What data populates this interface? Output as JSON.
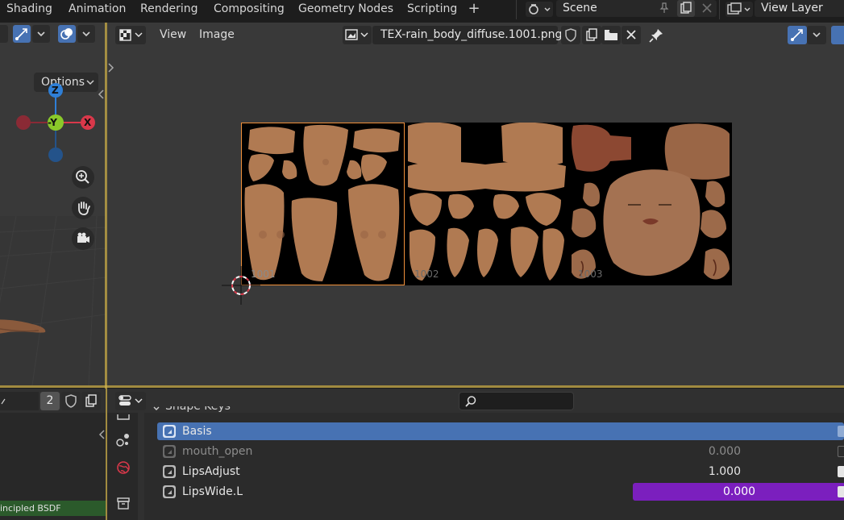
{
  "workspaces": [
    {
      "label": "Shading"
    },
    {
      "label": "Animation"
    },
    {
      "label": "Rendering"
    },
    {
      "label": "Compositing"
    },
    {
      "label": "Geometry Nodes"
    },
    {
      "label": "Scripting"
    }
  ],
  "add_workspace_label": "+",
  "scene": {
    "label": "Scene"
  },
  "view_layer": {
    "label": "View Layer"
  },
  "viewport3d": {
    "options_label": "Options",
    "gizmo": {
      "z": "Z",
      "y": "-Y",
      "x": "X"
    }
  },
  "image_editor": {
    "menu": {
      "view": "View",
      "image": "Image"
    },
    "image_name": "TEX-rain_body_diffuse.1001.png",
    "udim_tiles": [
      "1001",
      "1002",
      "1003"
    ]
  },
  "bottom_left": {
    "users_count": "2",
    "node_label": "incipled BSDF"
  },
  "properties": {
    "panel_title": "Shape Keys",
    "shape_keys": [
      {
        "name": "Basis",
        "value": "",
        "selected": true,
        "muted": false
      },
      {
        "name": "mouth_open",
        "value": "0.000",
        "selected": false,
        "muted": true
      },
      {
        "name": "LipsAdjust",
        "value": "1.000",
        "selected": false,
        "muted": false
      },
      {
        "name": "LipsWide.L",
        "value": "0.000",
        "selected": false,
        "muted": false,
        "slider": true
      }
    ]
  },
  "colors": {
    "accent_blue": "#4772b3",
    "area_divider": "#ceb04c",
    "slider_purple": "#7b1fbe",
    "axis_x": "#d9384a",
    "axis_y": "#8ac92a",
    "axis_z": "#2f7fd6",
    "skin": "#b07a52"
  }
}
